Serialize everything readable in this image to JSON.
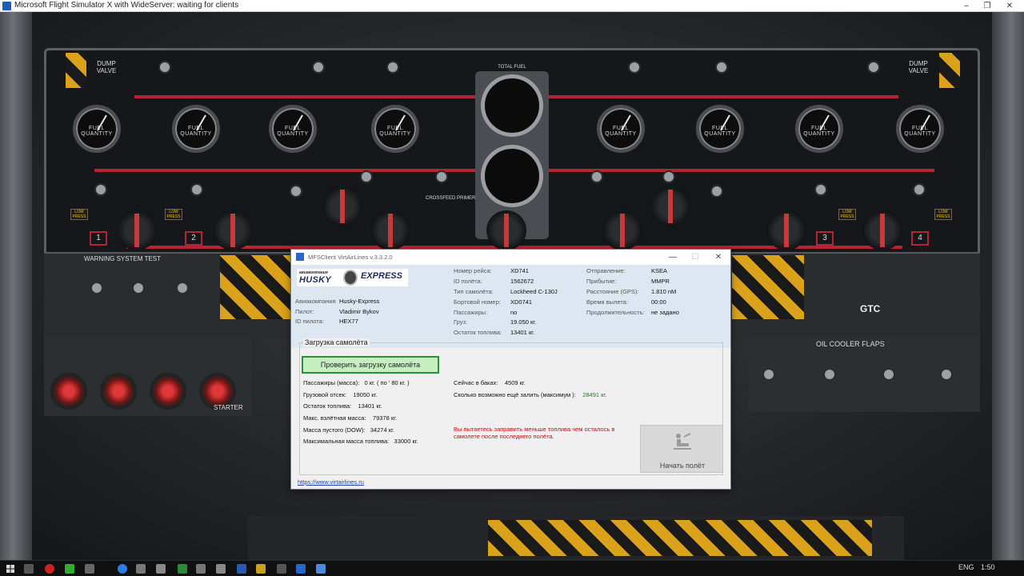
{
  "window": {
    "title": "Microsoft Flight Simulator X with WideServer: waiting for clients",
    "minimize": "–",
    "maximize": "❐",
    "close": "✕"
  },
  "dialog": {
    "title": "MFSClient VirtAirLines v.3.3.2.0",
    "minimize": "—",
    "maximize": "☐",
    "close": "✕",
    "logo": {
      "top": "авиакомпания",
      "husky": "HUSKY",
      "express": "EXPRESS"
    },
    "pilot": {
      "airline_label": "Авиакомпания",
      "airline": "Husky-Express",
      "pilot_label": "Пилот:",
      "pilot": "Vladimir Bykov",
      "pilot_id_label": "ID пилота:",
      "pilot_id": "HEX77"
    },
    "flight": {
      "flight_no_label": "Номер рейса:",
      "flight_no": "XD741",
      "flight_id_label": "ID полёта:",
      "flight_id": "1562672",
      "aircraft_type_label": "Тип самолёта:",
      "aircraft_type": "Lockheed C-130J",
      "tail_label": "Бортовой номер:",
      "tail": "XD0741",
      "pax_label": "Пассажиры:",
      "pax": "no",
      "cargo_label": "Груз:",
      "cargo": "19.050 кг.",
      "fuel_label": "Остаток топлива:",
      "fuel": "13401 кг."
    },
    "route": {
      "dep_label": "Отправление:",
      "dep": "KSEA",
      "arr_label": "Прибытие:",
      "arr": "MMPR",
      "dist_label": "Расстояние (GPS):",
      "dist": "1.810 nM",
      "deptime_label": "Время вылета:",
      "deptime": "00:00",
      "duration_label": "Продолжительность:",
      "duration": "не задано"
    },
    "loading": {
      "group_title": "Загрузка самолёта",
      "check_button": "Проверить загрузку самолёта",
      "pax_mass_label": "Пассажиры (масса):",
      "pax_mass": "0 кг. ( по ' 80 кг. )",
      "cargo_label": "Грузовой отсек:",
      "cargo": "19050 кг.",
      "fuel_left_label": "Остаток топлива:",
      "fuel_left": "13401 кг.",
      "mtow_label": "Макс. взлётная масса:",
      "mtow": "79378 кг.",
      "dow_label": "Масса пустого (DOW):",
      "dow": "34274 кг.",
      "max_fuel_label": "Максимальная масса топлива:",
      "max_fuel": "33000 кг.",
      "tanks_now_label": "Сейчас в баках:",
      "tanks_now": "4509 кг.",
      "can_fill_label": "Сколько возможно ещё залить (максимум ):",
      "can_fill": "28491 кг.",
      "warning": "Вы пытаетесь заправить меньше топлива чем осталось в самолете после последнего полёта.",
      "start_button": "Начать полёт"
    },
    "link": "https://www.virtairlines.ru"
  },
  "panel": {
    "dump_valve_left": "DUMP VALVE",
    "dump_valve_right": "DUMP VALVE",
    "total_fuel": "TOTAL FUEL",
    "fuel_quantity": "FUEL QUANTITY",
    "crossfeed_primer": "CROSSFEED PRIMER",
    "warning_system_test": "WARNING SYSTEM TEST",
    "oil_cooler_flaps": "OIL COOLER FLAPS",
    "starter": "STARTER",
    "gtc": "GTC",
    "low_press": "LOW PRESS",
    "engines": [
      "1",
      "2",
      "3",
      "4"
    ]
  },
  "taskbar": {
    "lang": "ENG",
    "time": "1:50"
  },
  "colors": {
    "fuel_line": "#b52334",
    "check_button_bg": "#c6efc1",
    "warning_text": "#c01010",
    "link": "#1a40c0"
  }
}
